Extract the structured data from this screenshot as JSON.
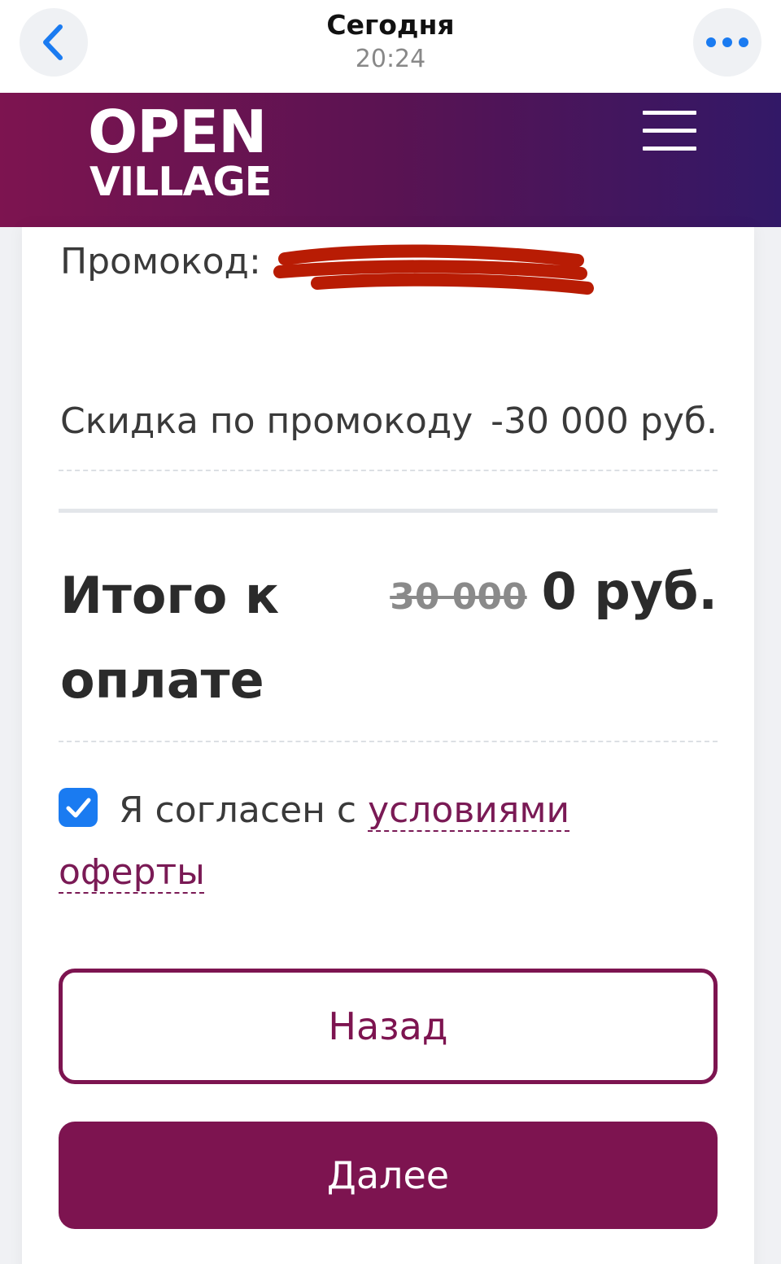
{
  "topbar": {
    "title": "Сегодня",
    "time": "20:24"
  },
  "site": {
    "logo_line1": "OPEN",
    "logo_line2": "VILLAGE",
    "header_gradient": [
      "#7d1450",
      "#321867"
    ]
  },
  "order": {
    "promo_label": "Промокод:",
    "discount_label": "Скидка по промокоду",
    "discount_value": "-30 000 руб.",
    "total_label": "Итого к оплате",
    "old_price": "30 000",
    "new_price": "0 руб."
  },
  "agreement": {
    "checked": true,
    "text": "Я согласен с ",
    "link_text": "условиями оферты"
  },
  "buttons": {
    "back_label": "Назад",
    "next_label": "Далее"
  },
  "colors": {
    "accent": "#7d1450",
    "checkbox": "#1a7bf1",
    "ios_blue": "#1a7bf1",
    "redaction": "#b81c04"
  },
  "icons": {
    "back": "chevron-left-icon",
    "more": "ellipsis-icon",
    "menu": "hamburger-menu-icon",
    "check": "checkmark-icon"
  }
}
